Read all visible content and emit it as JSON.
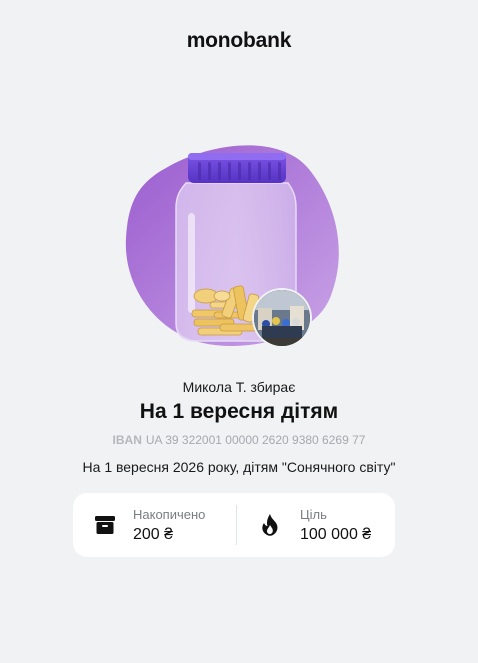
{
  "header": {
    "brand": "monobank"
  },
  "jar": {
    "collector": "Микола Т. збирає",
    "title": "На 1 вересня дітям",
    "iban_label": "IBAN",
    "iban": "UA 39 322001 00000 2620 9380 6269 77",
    "description": "На 1 вересня 2026 року, дітям \"Сонячного світу\""
  },
  "stats": {
    "accumulated": {
      "label": "Накопичено",
      "value": "200 ₴",
      "icon": "archive-box-icon"
    },
    "goal": {
      "label": "Ціль",
      "value": "100 000 ₴",
      "icon": "flame-icon"
    }
  },
  "colors": {
    "background": "#f1f2f4",
    "blob": "#a06dcf",
    "lid": "#6b43d8",
    "card": "#ffffff"
  }
}
